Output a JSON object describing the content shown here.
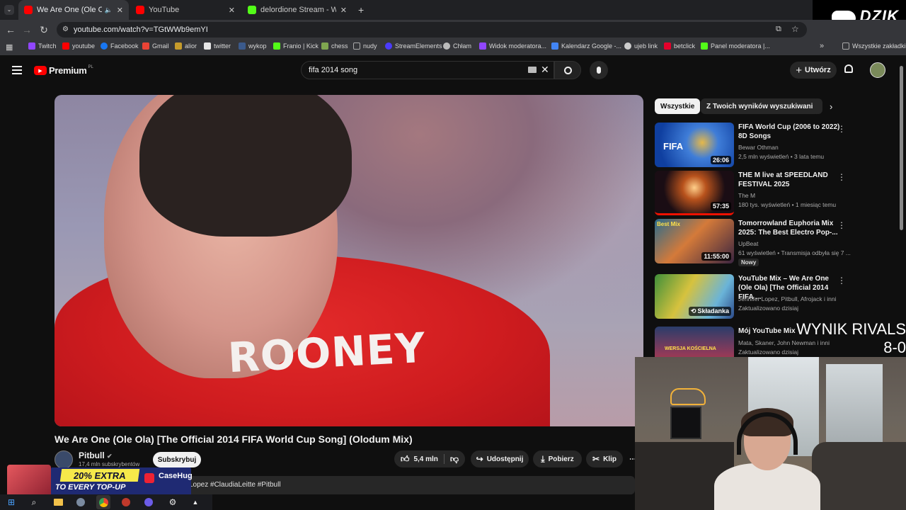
{
  "browser": {
    "tabs": [
      {
        "title": "We Are One (Ole Ola) [The",
        "favicon_color": "#ff0000",
        "active": true
      },
      {
        "title": "YouTube",
        "favicon_color": "#ff0000",
        "active": false
      },
      {
        "title": "delordione Stream - Watch Live",
        "favicon_color": "#53fc18",
        "active": false
      }
    ],
    "url": "youtube.com/watch?v=TGtWWb9emYI",
    "bookmarks": [
      {
        "label": "Twitch",
        "color": "#9146ff"
      },
      {
        "label": "youtube",
        "color": "#ff0000"
      },
      {
        "label": "Facebook",
        "color": "#1877f2"
      },
      {
        "label": "Gmail",
        "color": "#ea4335"
      },
      {
        "label": "alior",
        "color": "#c59b2b"
      },
      {
        "label": "twitter",
        "color": "#e7e7e7"
      },
      {
        "label": "wykop",
        "color": "#3b5a8c"
      },
      {
        "label": "Franio | Kick",
        "color": "#53fc18"
      },
      {
        "label": "chess",
        "color": "#7fa650"
      },
      {
        "label": "nudy",
        "color": "#aaaaaa"
      },
      {
        "label": "StreamElements",
        "color": "#4b3bff"
      },
      {
        "label": "Chłam",
        "color": "#bbbbbb"
      },
      {
        "label": "Widok moderatora...",
        "color": "#9146ff"
      },
      {
        "label": "Kalendarz Google -...",
        "color": "#4285f4"
      },
      {
        "label": "ujeb link",
        "color": "#cccccc"
      },
      {
        "label": "betclick",
        "color": "#e4002b"
      },
      {
        "label": "Panel moderatora |...",
        "color": "#53fc18"
      }
    ],
    "all_bookmarks": "Wszystkie zakładki"
  },
  "overlay": {
    "brand": "DZIK",
    "rivals_line1": "WYNIK RIVALS",
    "rivals_line2": "8-0",
    "promo_extra": "20% EXTRA",
    "promo_topup": "TO EVERY TOP-UP",
    "promo_brand": "CaseHug"
  },
  "youtube": {
    "logo": "Premium",
    "logo_region": "PL",
    "search_value": "fifa 2014 song",
    "create_label": "Utwórz",
    "video": {
      "jersey_text": "ROONEY",
      "title": "We Are One (Ole Ola) [The Official 2014 FIFA World Cup Song] (Olodum Mix)",
      "channel": "Pitbull",
      "subscribers": "17,4 mln subskrybentów",
      "subscribe_label": "Subskrybuj",
      "likes": "5,4 mln",
      "share_label": "Udostępnij",
      "download_label": "Pobierz",
      "clip_label": "Klip",
      "description_tags": "Lopez #ClaudiaLeitte #Pitbull"
    },
    "chips": [
      "Wszystkie",
      "Z Twoich wyników wyszukiwania"
    ],
    "recommendations": [
      {
        "title": "FIFA World Cup (2006 to 2022) 8D Songs",
        "channel": "Bewar Othman",
        "meta": "2,5 mln wyświetleń • 3 lata temu",
        "duration": "26:06",
        "badge": ""
      },
      {
        "title": "THE M live at SPEEDLAND FESTIVAL 2025",
        "channel": "The M",
        "meta": "180 tys. wyświetleń • 1 miesiąc temu",
        "duration": "57:35",
        "badge": ""
      },
      {
        "title": "Tomorrowland Euphoria Mix 2025: The Best Electro Pop-...",
        "channel": "UpBeat",
        "meta": "61 wyświetleń • Transmisja odbyła się 7 ...",
        "duration": "11:55:00",
        "badge": "Nowy"
      },
      {
        "title": "YouTube Mix – We Are One (Ole Ola) [The Official 2014 FIFA ...",
        "channel": "Jennifer Lopez, Pitbull, Afrojack i inni",
        "meta": "Zaktualizowano dzisiaj",
        "duration": "Składanka",
        "badge": ""
      },
      {
        "title": "Mój YouTube Mix",
        "channel": "Mata, Skaner, John Newman i inni",
        "meta": "Zaktualizowano dzisiaj",
        "duration": "",
        "badge": ""
      }
    ]
  }
}
